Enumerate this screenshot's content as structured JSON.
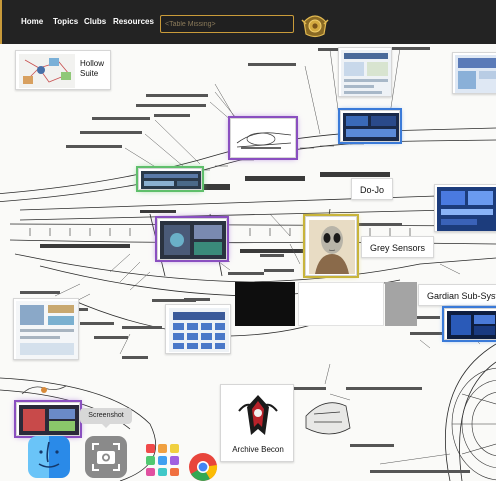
{
  "nav": {
    "items": [
      "Home",
      "Topics",
      "Clubs",
      "Resources"
    ],
    "search_placeholder": "<Table Missing>"
  },
  "cards": {
    "hollow_suite": "Hollow Suite",
    "dojo": "Do-Jo",
    "grey_sensors": "Grey Sensors",
    "gardian": "Gardian Sub-Systems",
    "archive_becon": "Archive Becon"
  },
  "dock": {
    "tooltip": "Screenshot",
    "apps": [
      "finder",
      "screenshot",
      "launchpad",
      "chrome"
    ]
  },
  "colors": {
    "topbar": "#232323",
    "accent_gold": "#c99b3a",
    "glow_green": "#5fbf6b",
    "glow_purple": "#8a4fc0",
    "glow_yellow": "#c8b43a"
  }
}
